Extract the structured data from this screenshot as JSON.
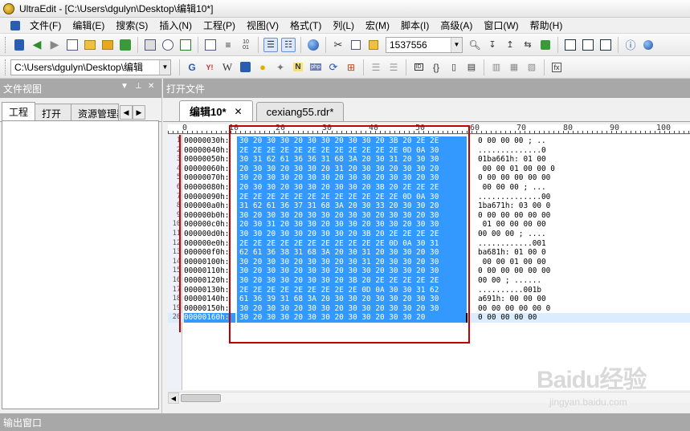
{
  "window": {
    "title": "UltraEdit - [C:\\Users\\dgulyn\\Desktop\\编辑10*]"
  },
  "menu": [
    "文件(F)",
    "编辑(E)",
    "搜索(S)",
    "插入(N)",
    "工程(P)",
    "视图(V)",
    "格式(T)",
    "列(L)",
    "宏(M)",
    "脚本(I)",
    "高级(A)",
    "窗口(W)",
    "帮助(H)"
  ],
  "toolbar1": {
    "search_value": "1537556"
  },
  "toolbar2": {
    "path_value": "C:\\Users\\dgulyn\\Desktop\\编辑"
  },
  "side_panel": {
    "title": "文件视图",
    "tabs": [
      "工程",
      "打开",
      "资源管理器"
    ]
  },
  "editor": {
    "open_files_title": "打开文件",
    "tabs": [
      {
        "label": "编辑10*",
        "active": true
      },
      {
        "label": "cexiang55.rdr*",
        "active": false
      }
    ],
    "ruler_marks": [
      "0",
      "10",
      "20",
      "30",
      "40",
      "50",
      "60",
      "70",
      "80",
      "90",
      "100"
    ],
    "rows": [
      {
        "n": "1",
        "addr": "00000030h:",
        "hex": "30 20 30 30 20 30 30 20 30 30 20 3B 20 2E 2E",
        "ascii": "0 00 00 00 ; .."
      },
      {
        "n": "2",
        "addr": "00000040h:",
        "hex": "2E 2E 2E 2E 2E 2E 2E 2E 2E 2E 2E 2E 0D 0A 30",
        "ascii": "..............0"
      },
      {
        "n": "3",
        "addr": "00000050h:",
        "hex": "30 31 62 61 36 36 31 68 3A 20 30 31 20 30 30",
        "ascii": "01ba661h: 01 00"
      },
      {
        "n": "4",
        "addr": "00000060h:",
        "hex": "20 30 30 20 30 30 20 31 20 30 30 20 30 30 20",
        "ascii": " 00 00 01 00 00 0"
      },
      {
        "n": "5",
        "addr": "00000070h:",
        "hex": "30 20 30 30 20 30 30 20 30 30 20 30 30 20 30",
        "ascii": "0 00 00 00 00 00"
      },
      {
        "n": "6",
        "addr": "00000080h:",
        "hex": "20 30 30 20 30 30 20 30 30 20 3B 20 2E 2E 2E",
        "ascii": " 00 00 00 ; ..."
      },
      {
        "n": "7",
        "addr": "00000090h:",
        "hex": "2E 2E 2E 2E 2E 2E 2E 2E 2E 2E 2E 2E 0D 0A 30",
        "ascii": "..............00"
      },
      {
        "n": "8",
        "addr": "000000a0h:",
        "hex": "31 62 61 36 37 31 68 3A 20 30 33 20 30 30 20",
        "ascii": "1ba671h: 03 00 0"
      },
      {
        "n": "9",
        "addr": "000000b0h:",
        "hex": "30 20 30 30 20 30 30 20 30 30 20 30 30 20 30",
        "ascii": "0 00 00 00 00 00"
      },
      {
        "n": "10",
        "addr": "000000c0h:",
        "hex": "20 30 31 20 30 30 20 30 30 20 30 30 20 30 30",
        "ascii": " 01 00 00 00 00"
      },
      {
        "n": "11",
        "addr": "000000d0h:",
        "hex": "30 30 20 30 30 20 30 30 20 3B 20 2E 2E 2E 2E",
        "ascii": "00 00 00 ; ...."
      },
      {
        "n": "12",
        "addr": "000000e0h:",
        "hex": "2E 2E 2E 2E 2E 2E 2E 2E 2E 2E 2E 0D 0A 30 31",
        "ascii": "............001"
      },
      {
        "n": "13",
        "addr": "000000f0h:",
        "hex": "62 61 36 38 31 68 3A 20 30 31 20 30 30 20 30",
        "ascii": "ba681h: 01 00 0"
      },
      {
        "n": "14",
        "addr": "00000100h:",
        "hex": "30 20 30 30 20 30 30 20 30 31 20 30 30 20 30",
        "ascii": " 00 00 01 00 00"
      },
      {
        "n": "15",
        "addr": "00000110h:",
        "hex": "30 20 30 30 20 30 30 20 30 30 20 30 30 20 30",
        "ascii": "0 00 00 00 00 00"
      },
      {
        "n": "16",
        "addr": "00000120h:",
        "hex": "30 20 30 30 20 30 30 20 3B 20 2E 2E 2E 2E 2E",
        "ascii": "00 00 ; ......"
      },
      {
        "n": "17",
        "addr": "00000130h:",
        "hex": "2E 2E 2E 2E 2E 2E 2E 2E 2E 0D 0A 30 30 31 62",
        "ascii": "..........001b"
      },
      {
        "n": "18",
        "addr": "00000140h:",
        "hex": "61 36 39 31 68 3A 20 30 30 20 30 30 20 30 30",
        "ascii": "a691h: 00 00 00"
      },
      {
        "n": "19",
        "addr": "00000150h:",
        "hex": "30 20 30 30 20 30 30 20 30 30 20 30 30 20 30",
        "ascii": "00 00 00 00 00 0"
      },
      {
        "n": "20",
        "addr": "00000160h:",
        "hex": "30 20 30 30 20 30 30 20 30 30 20 30 30 20",
        "ascii": "0 00 00 00 00"
      }
    ]
  },
  "output_panel": {
    "title": "输出窗口"
  },
  "watermark": {
    "logo": "Baidu经验",
    "url": "jingyan.baidu.com"
  },
  "colors": {
    "selection": "#3399ff",
    "highlight_box": "#c00000",
    "panel_header": "#a8a8a8"
  }
}
